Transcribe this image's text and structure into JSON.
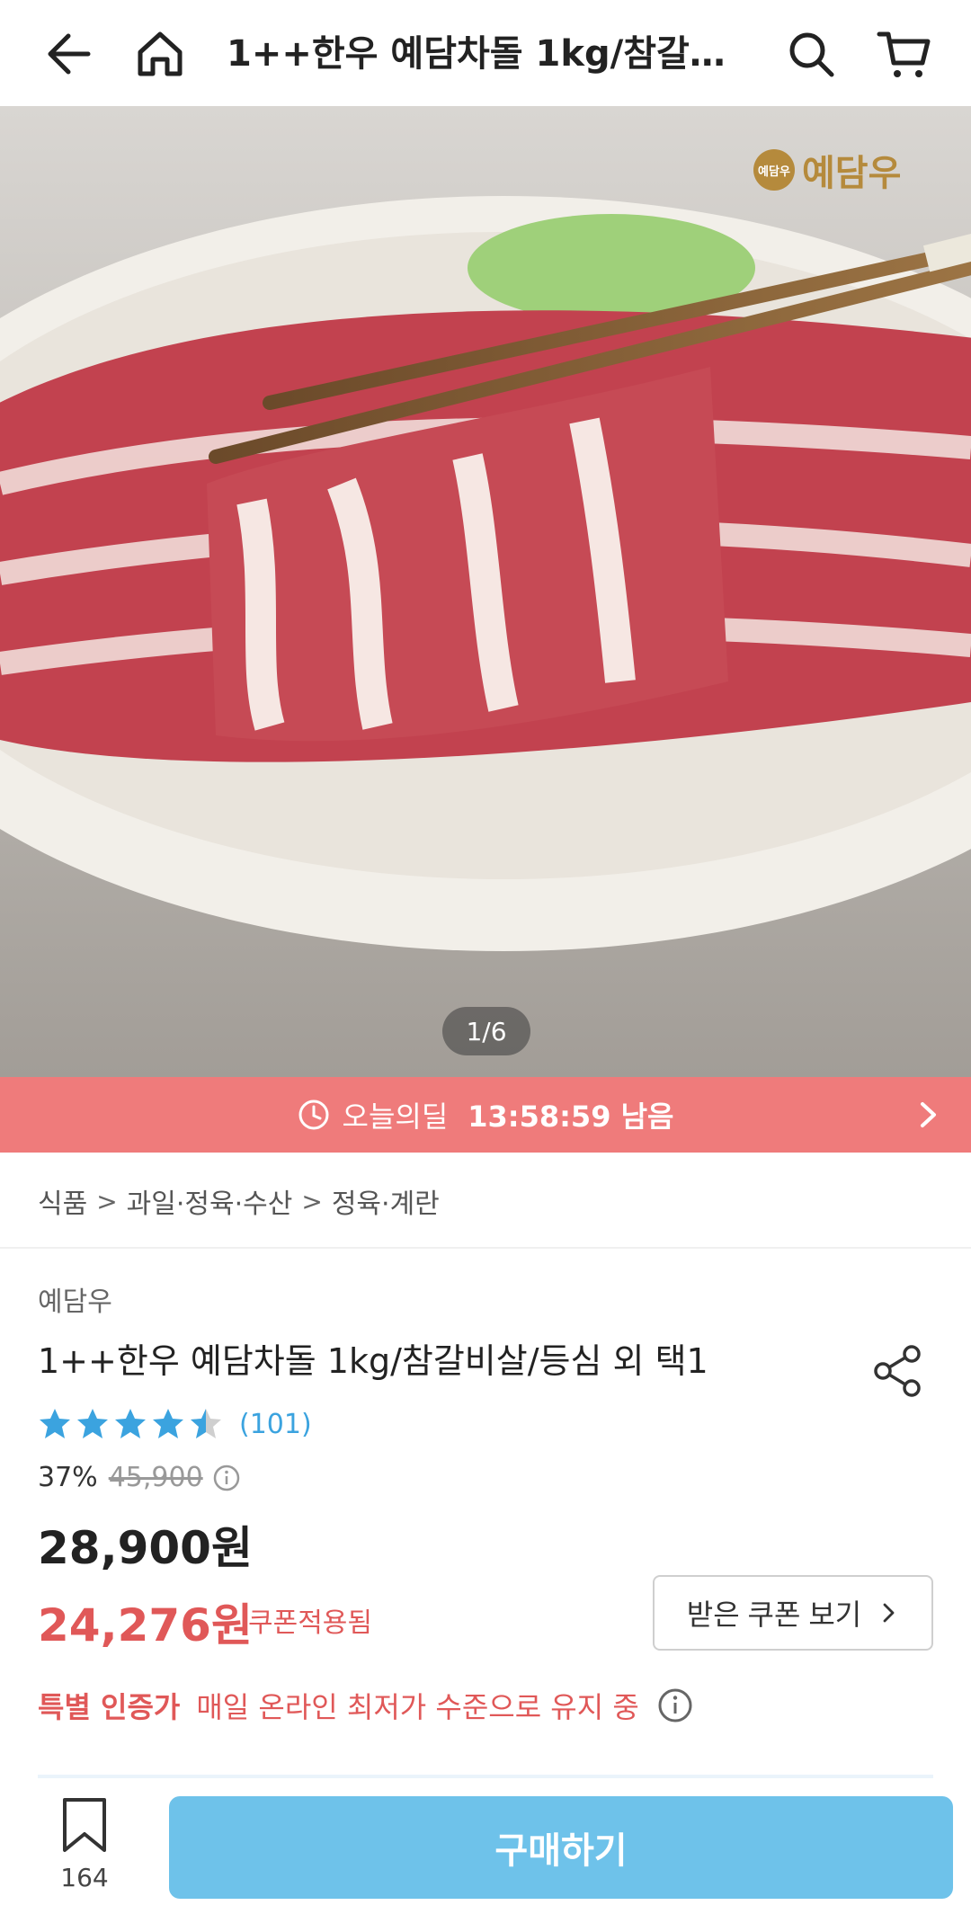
{
  "header": {
    "title": "1++한우 예담차돌 1kg/참갈비…",
    "icons": [
      "back-arrow-icon",
      "home-icon",
      "search-icon",
      "cart-icon"
    ]
  },
  "hero": {
    "brand_seal": "예담우",
    "brand_name": "예담우",
    "page_indicator": "1/6"
  },
  "deal": {
    "label": "오늘의딜",
    "time_left": "13:58:59 남음",
    "color": "#ef7b7b"
  },
  "breadcrumb": {
    "items": [
      "식품",
      "과일·정육·수산",
      "정육·계란"
    ],
    "separator": ">"
  },
  "product": {
    "seller": "예담우",
    "title": "1++한우 예담차돌 1kg/참갈비살/등심 외 택1",
    "rating": 4.5,
    "review_count": "(101)",
    "discount_rate": "37%",
    "original_price": "45,900",
    "price": "28,900원",
    "coupon_price": "24,276원",
    "coupon_applied": "쿠폰적용됨",
    "coupon_button": "받은 쿠폰 보기",
    "special_label": "특별 인증가",
    "special_desc": "매일 온라인 최저가 수준으로 유지 중",
    "accent_red": "#e05858",
    "accent_blue": "#3ba3df"
  },
  "bottom_bar": {
    "wishlist_count": "164",
    "buy_label": "구매하기",
    "buy_color": "#6ec2ea"
  }
}
